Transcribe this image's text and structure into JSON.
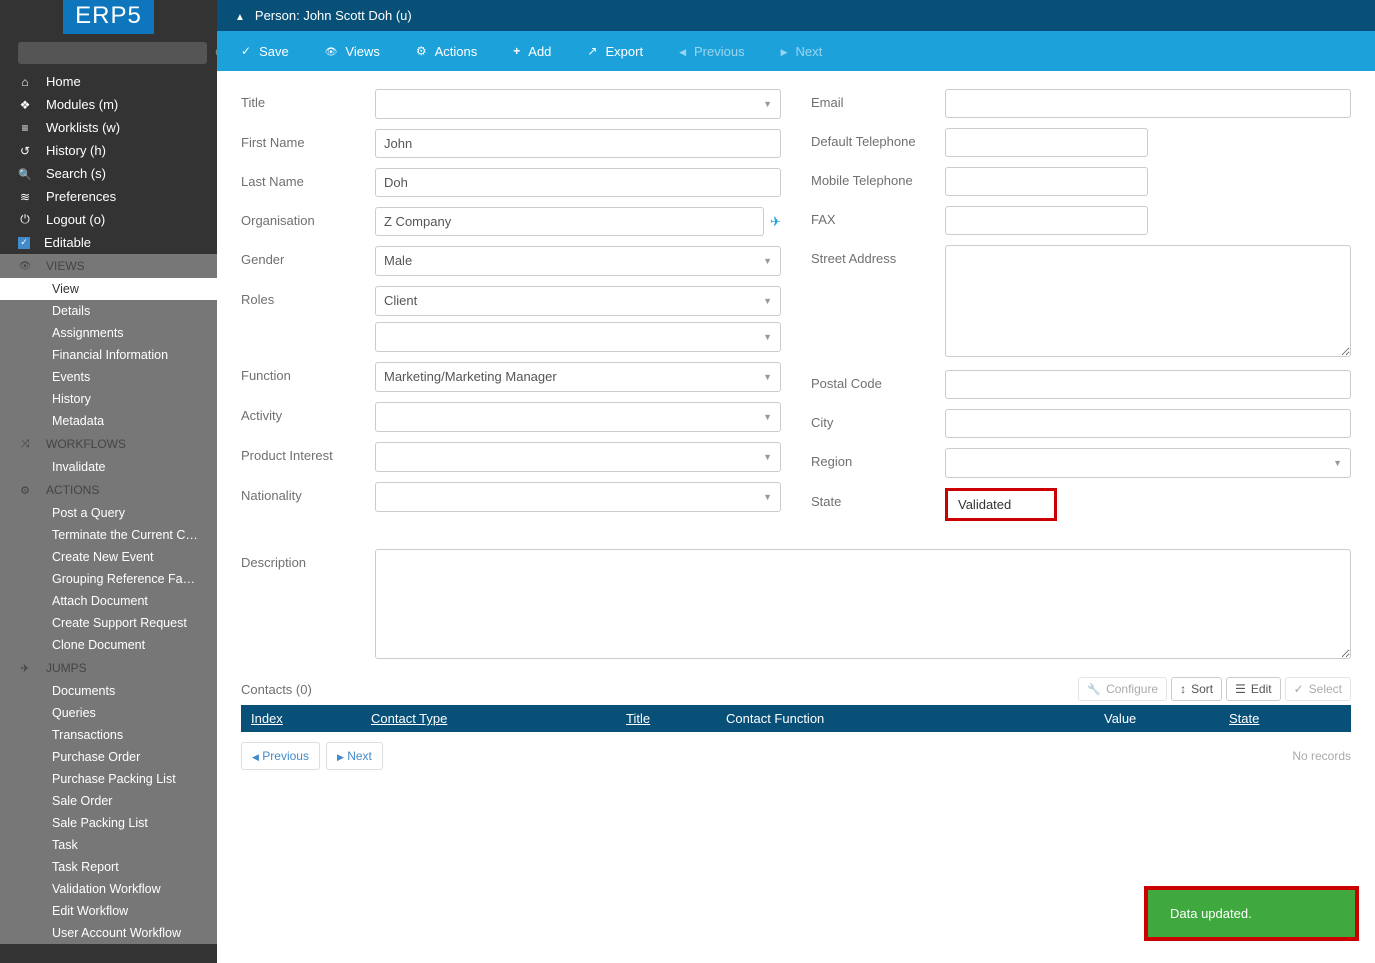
{
  "brand": "ERP5",
  "nav": {
    "home": "Home",
    "modules": "Modules (m)",
    "worklists": "Worklists (w)",
    "history": "History (h)",
    "search": "Search (s)",
    "preferences": "Preferences",
    "logout": "Logout (o)",
    "editable": "Editable"
  },
  "sections": {
    "views": {
      "label": "VIEWS",
      "items": [
        "View",
        "Details",
        "Assignments",
        "Financial Information",
        "Events",
        "History",
        "Metadata"
      ]
    },
    "workflows": {
      "label": "WORKFLOWS",
      "items": [
        "Invalidate"
      ]
    },
    "actions": {
      "label": "ACTIONS",
      "items": [
        "Post a Query",
        "Terminate the Current Career...",
        "Create New Event",
        "Grouping Reference Fast Input",
        "Attach Document",
        "Create Support Request",
        "Clone Document"
      ]
    },
    "jumps": {
      "label": "JUMPS",
      "items": [
        "Documents",
        "Queries",
        "Transactions",
        "Purchase Order",
        "Purchase Packing List",
        "Sale Order",
        "Sale Packing List",
        "Task",
        "Task Report",
        "Validation Workflow",
        "Edit Workflow",
        "User Account Workflow"
      ]
    }
  },
  "breadcrumb": "Person: John Scott Doh (u)",
  "toolbar": {
    "save": "Save",
    "views": "Views",
    "actions": "Actions",
    "add": "Add",
    "export": "Export",
    "previous": "Previous",
    "next": "Next"
  },
  "labels": {
    "title": "Title",
    "first_name": "First Name",
    "last_name": "Last Name",
    "organisation": "Organisation",
    "gender": "Gender",
    "roles": "Roles",
    "function": "Function",
    "activity": "Activity",
    "product_interest": "Product Interest",
    "nationality": "Nationality",
    "description": "Description",
    "email": "Email",
    "default_tel": "Default Telephone",
    "mobile_tel": "Mobile Telephone",
    "fax": "FAX",
    "street": "Street Address",
    "postal": "Postal Code",
    "city": "City",
    "region": "Region",
    "state": "State"
  },
  "values": {
    "title": "",
    "first_name": "John",
    "last_name": "Doh",
    "organisation": "Z Company",
    "gender": "Male",
    "role1": "Client",
    "role2": "",
    "function": "Marketing/Marketing Manager",
    "activity": "",
    "product_interest": "",
    "nationality": "",
    "description": "",
    "email": "",
    "default_tel": "",
    "mobile_tel": "",
    "fax": "",
    "street": "",
    "postal": "",
    "city": "",
    "region": "",
    "state": "Validated"
  },
  "contacts": {
    "title": "Contacts (0)",
    "tools": {
      "configure": "Configure",
      "sort": "Sort",
      "edit": "Edit",
      "select": "Select"
    },
    "cols": {
      "index": "Index",
      "contact_type": "Contact Type",
      "title": "Title",
      "contact_function": "Contact Function",
      "value": "Value",
      "state": "State"
    },
    "pager": {
      "prev": "Previous",
      "next": "Next"
    },
    "empty": "No records"
  },
  "toast": "Data updated."
}
